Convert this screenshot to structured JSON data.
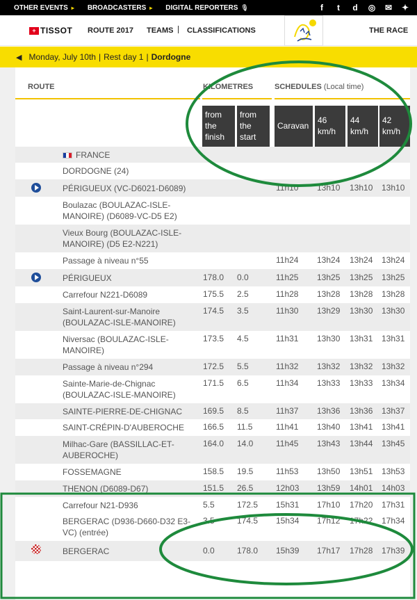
{
  "topbar": {
    "items": [
      {
        "label": "OTHER EVENTS",
        "marker": "▸"
      },
      {
        "label": "BROADCASTERS",
        "marker": "▸"
      },
      {
        "label": "DIGITAL REPORTERS",
        "marker": "🎙"
      }
    ],
    "socials": [
      "facebook-icon",
      "twitter-icon",
      "dailymotion-icon",
      "instagram-icon",
      "email-icon",
      "messenger-icon"
    ],
    "social_glyphs": [
      "f",
      "t",
      "d",
      "◎",
      "✉",
      "✦"
    ]
  },
  "nav": {
    "sponsor": "TISSOT",
    "route": "ROUTE 2017",
    "teams": "TEAMS",
    "classifications": "CLASSIFICATIONS",
    "the_race": "THE RACE"
  },
  "date_bar": {
    "prev": "◀",
    "date": "Monday, July 10th",
    "sep": "|",
    "stage": "Rest day 1",
    "sep2": "|",
    "region": "Dordogne"
  },
  "table": {
    "group_route": "ROUTE",
    "group_km": "KILOMETRES",
    "group_sched": "SCHEDULES",
    "group_sched_note": "(Local time)",
    "col_headers": [
      [
        "from",
        "the",
        "finish"
      ],
      [
        "from",
        "the",
        "start"
      ],
      [
        "Caravan"
      ],
      [
        "46",
        "km/h"
      ],
      [
        "44",
        "km/h"
      ],
      [
        "42",
        "km/h"
      ]
    ],
    "rows": [
      {
        "icon": "",
        "place": [
          "FRANCE"
        ],
        "flag": true,
        "vals": [
          "",
          "",
          "",
          "",
          "",
          ""
        ]
      },
      {
        "icon": "",
        "place": [
          "DORDOGNE (24)"
        ],
        "vals": [
          "",
          "",
          "",
          "",
          "",
          ""
        ]
      },
      {
        "icon": "play",
        "place": [
          "PÉRIGUEUX (VC-D6021-D6089)"
        ],
        "vals": [
          "",
          "",
          "11h10",
          "13h10",
          "13h10",
          "13h10"
        ]
      },
      {
        "icon": "",
        "place": [
          "Boulazac (BOULAZAC-ISLE-",
          "MANOIRE) (D6089-VC-D5 E2)"
        ],
        "vals": [
          "",
          "",
          "",
          "",
          "",
          ""
        ]
      },
      {
        "icon": "",
        "place": [
          "Vieux Bourg (BOULAZAC-ISLE-",
          "MANOIRE) (D5 E2-N221)"
        ],
        "vals": [
          "",
          "",
          "",
          "",
          "",
          ""
        ]
      },
      {
        "icon": "",
        "place": [
          "Passage à niveau n°55"
        ],
        "vals": [
          "",
          "",
          "11h24",
          "13h24",
          "13h24",
          "13h24"
        ]
      },
      {
        "icon": "play",
        "place": [
          "PÉRIGUEUX"
        ],
        "vals": [
          "178.0",
          "0.0",
          "11h25",
          "13h25",
          "13h25",
          "13h25"
        ]
      },
      {
        "icon": "",
        "place": [
          "Carrefour N221-D6089"
        ],
        "vals": [
          "175.5",
          "2.5",
          "11h28",
          "13h28",
          "13h28",
          "13h28"
        ]
      },
      {
        "icon": "",
        "place": [
          "Saint-Laurent-sur-Manoire",
          "(BOULAZAC-ISLE-MANOIRE)"
        ],
        "vals": [
          "174.5",
          "3.5",
          "11h30",
          "13h29",
          "13h30",
          "13h30"
        ]
      },
      {
        "icon": "",
        "place": [
          "Niversac (BOULAZAC-ISLE-",
          "MANOIRE)"
        ],
        "vals": [
          "173.5",
          "4.5",
          "11h31",
          "13h30",
          "13h31",
          "13h31"
        ]
      },
      {
        "icon": "",
        "place": [
          "Passage à niveau n°294"
        ],
        "vals": [
          "172.5",
          "5.5",
          "11h32",
          "13h32",
          "13h32",
          "13h32"
        ]
      },
      {
        "icon": "",
        "place": [
          "Sainte-Marie-de-Chignac",
          "(BOULAZAC-ISLE-MANOIRE)"
        ],
        "vals": [
          "171.5",
          "6.5",
          "11h34",
          "13h33",
          "13h33",
          "13h34"
        ]
      },
      {
        "icon": "",
        "place": [
          "SAINTE-PIERRE-DE-CHIGNAC"
        ],
        "vals": [
          "169.5",
          "8.5",
          "11h37",
          "13h36",
          "13h36",
          "13h37"
        ]
      },
      {
        "icon": "",
        "place": [
          "SAINT-CRÉPIN-D'AUBEROCHE"
        ],
        "vals": [
          "166.5",
          "11.5",
          "11h41",
          "13h40",
          "13h41",
          "13h41"
        ]
      },
      {
        "icon": "",
        "place": [
          "Milhac-Gare (BASSILLAC-ET-",
          "AUBEROCHE)"
        ],
        "vals": [
          "164.0",
          "14.0",
          "11h45",
          "13h43",
          "13h44",
          "13h45"
        ]
      },
      {
        "icon": "",
        "place": [
          "FOSSEMAGNE"
        ],
        "vals": [
          "158.5",
          "19.5",
          "11h53",
          "13h50",
          "13h51",
          "13h53"
        ]
      },
      {
        "icon": "",
        "place": [
          "THENON (D6089-D67)"
        ],
        "vals": [
          "151.5",
          "26.5",
          "12h03",
          "13h59",
          "14h01",
          "14h03"
        ]
      },
      {
        "icon": "",
        "place": [
          "Carrefour N21-D936"
        ],
        "vals": [
          "5.5",
          "172.5",
          "15h31",
          "17h10",
          "17h20",
          "17h31"
        ]
      },
      {
        "icon": "",
        "place": [
          "BERGERAC (D936-D660-D32 E3-",
          "VC) (entrée)"
        ],
        "vals": [
          "3.5",
          "174.5",
          "15h34",
          "17h12",
          "17h22",
          "17h34"
        ]
      },
      {
        "icon": "finish",
        "place": [
          "BERGERAC"
        ],
        "vals": [
          "0.0",
          "178.0",
          "15h39",
          "17h17",
          "17h28",
          "17h39"
        ]
      }
    ]
  },
  "colors": {
    "yellow": "#f8dd00",
    "header_box": "#3b3b3b",
    "annotation": "#1e8a3c"
  }
}
